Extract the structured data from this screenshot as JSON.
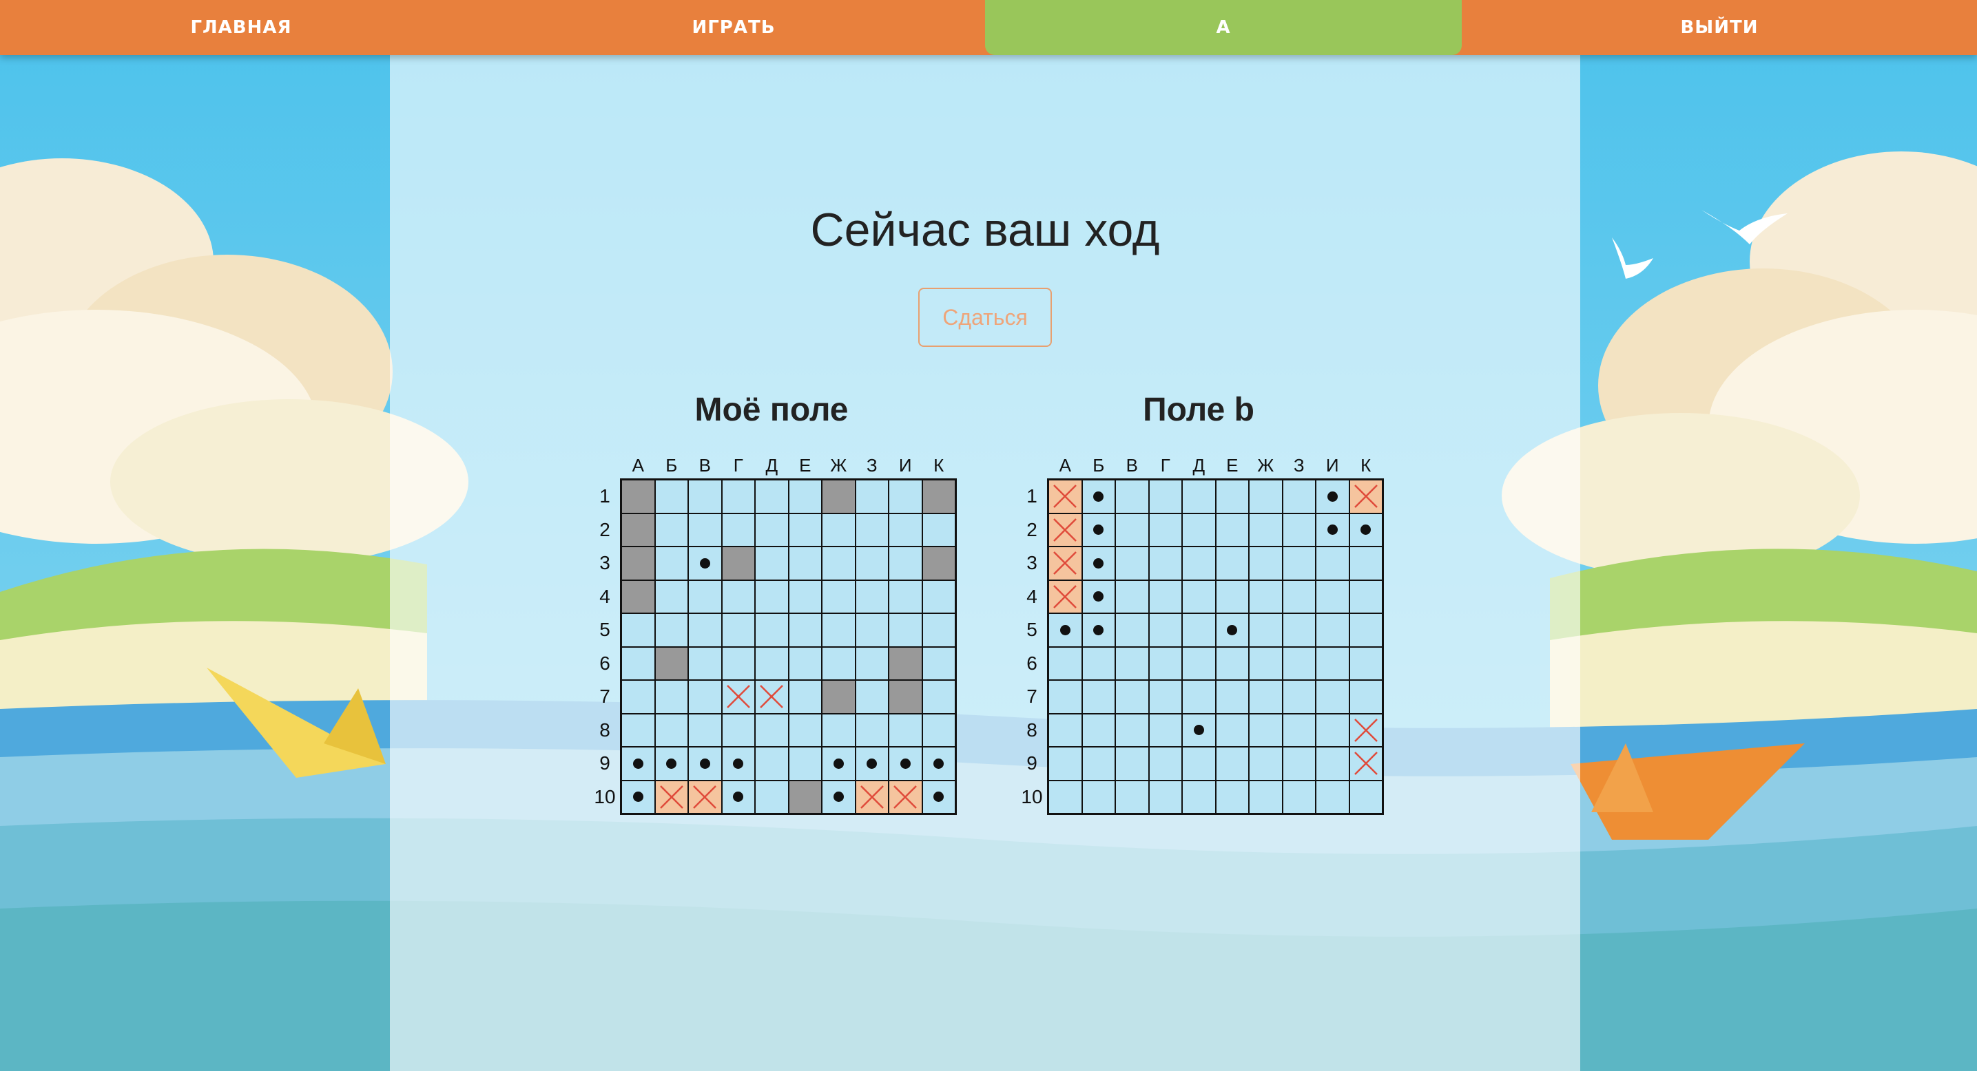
{
  "nav": {
    "home": "ГЛАВНАЯ",
    "play": "ИГРАТЬ",
    "user": "A",
    "logout": "ВЫЙТИ"
  },
  "game": {
    "turn_text": "Сейчас ваш ход",
    "surrender_label": "Сдаться"
  },
  "boards": {
    "columns": [
      "А",
      "Б",
      "В",
      "Г",
      "Д",
      "Е",
      "Ж",
      "З",
      "И",
      "К"
    ],
    "rows": [
      "1",
      "2",
      "3",
      "4",
      "5",
      "6",
      "7",
      "8",
      "9",
      "10"
    ],
    "legend": {
      "S": "ship",
      "H": "hit",
      "M": "miss",
      "X": "miss-cross",
      ".": "water"
    },
    "my_board": {
      "title": "Моё поле",
      "cells": [
        "S.....S..S",
        "S.........",
        "S.MS.....S",
        "S.........",
        "..........",
        ".S......S.",
        "...XX.S.S.",
        "..........",
        "MMMM..MMMM",
        "MHHM.SMHHM"
      ]
    },
    "enemy_board": {
      "title": "Поле b",
      "cells": [
        "HM......MH",
        "HM......MM",
        "HM........",
        "HM........",
        "MM...M....",
        "..........",
        "..........",
        "....M....X",
        ".........X",
        ".........."
      ]
    }
  },
  "colors": {
    "nav_bg": "#e8803d",
    "nav_active": "#99c65a",
    "water": "#b9e4f4",
    "ship": "#999999",
    "hit": "#f5c49e",
    "cross": "#e04a3a"
  }
}
